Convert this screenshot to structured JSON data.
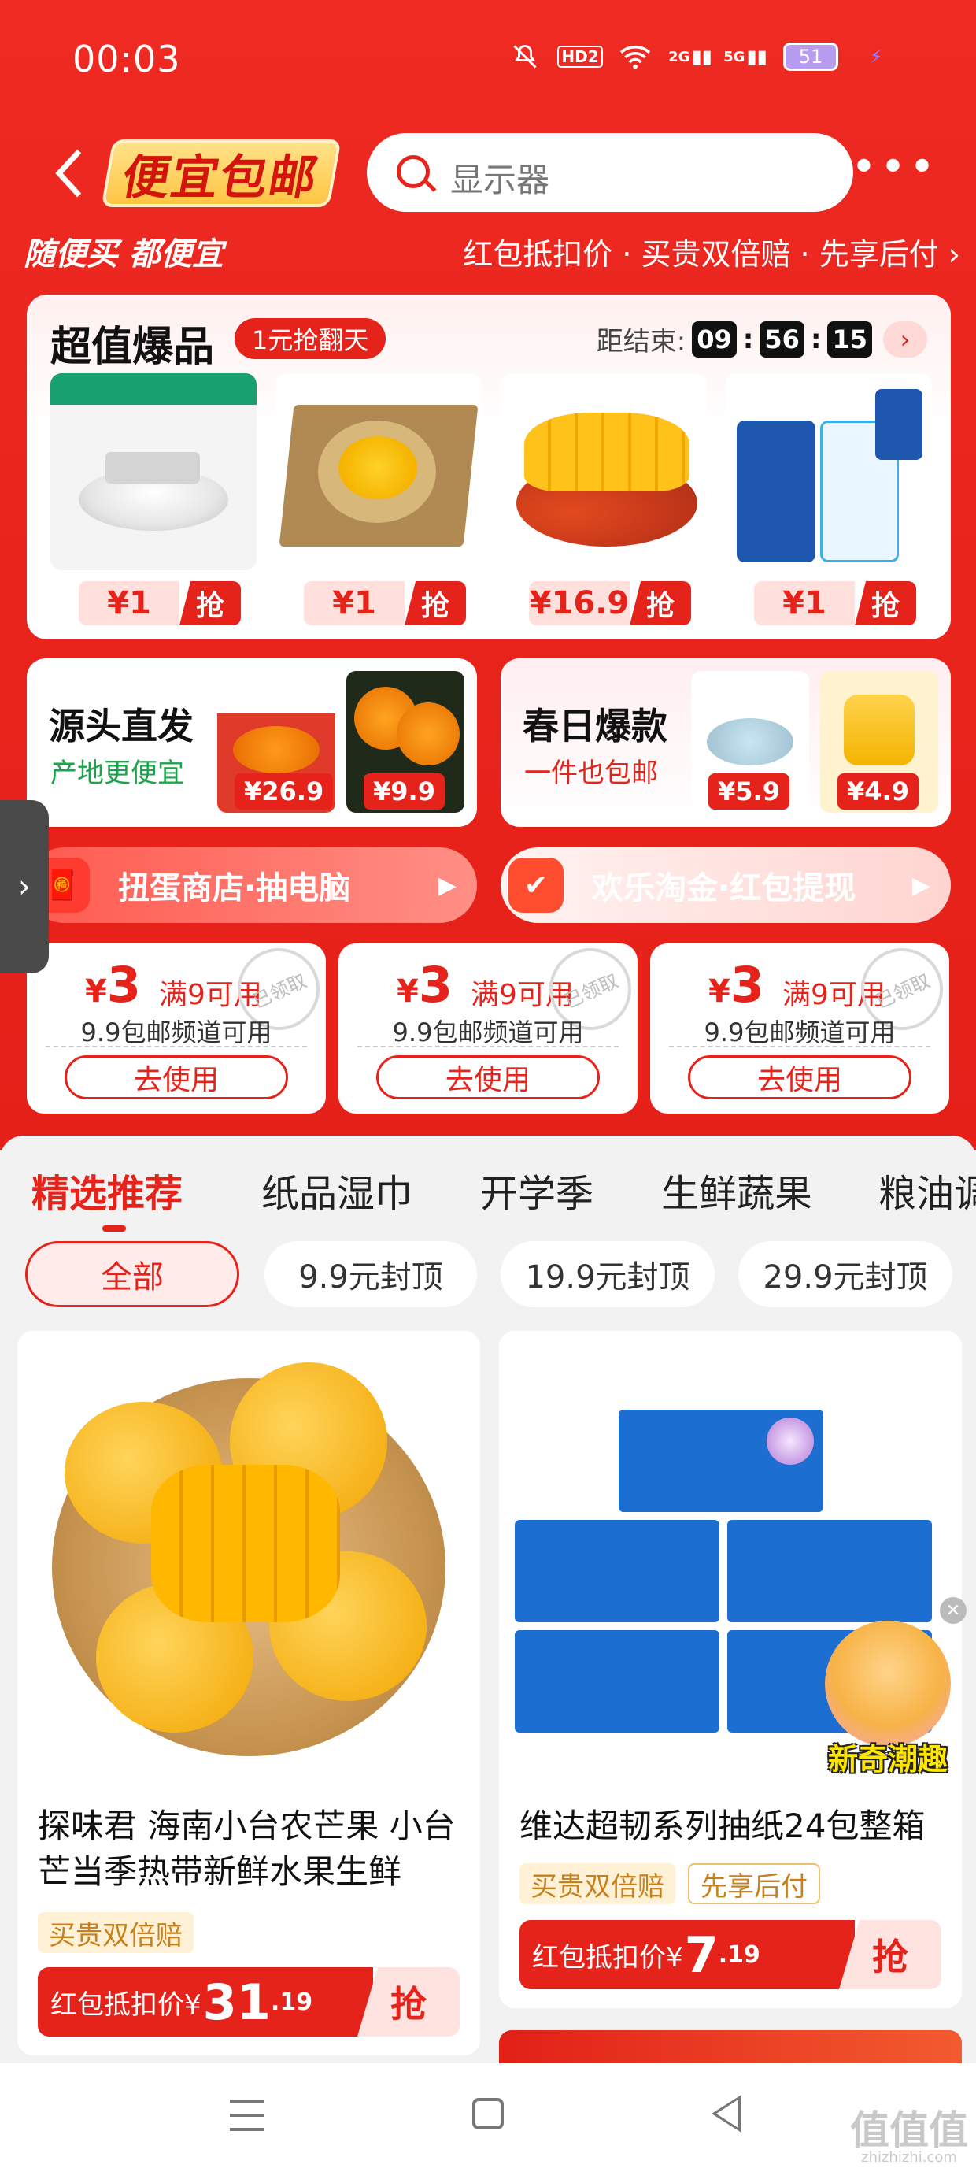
{
  "status_bar": {
    "time": "00:03",
    "icons": [
      "mute-icon",
      "hd-icon",
      "wifi-icon",
      "signal-2g-icon",
      "signal-5g-icon",
      "charging-icon"
    ],
    "hd_label": "HD2",
    "signal_1": "2G",
    "signal_2": "5G",
    "battery": "51"
  },
  "header": {
    "brand": "便宜包邮",
    "search_placeholder": "显示器"
  },
  "slogan": {
    "left": "随便买 都便宜",
    "right": "红包抵扣价 · 买贵双倍赔 · 先享后付 ›"
  },
  "hot_deals": {
    "title": "超值爆品",
    "tag": "1元抢翻天",
    "countdown_label": "距结束:",
    "hours": "09",
    "minutes": "56",
    "seconds": "15",
    "items": [
      {
        "price": "¥1",
        "button": "抢",
        "image": "downlight-icon"
      },
      {
        "price": "¥1",
        "button": "抢",
        "image": "dried-fruit-icon"
      },
      {
        "price": "¥16.9",
        "button": "抢",
        "image": "mango-icon"
      },
      {
        "price": "¥1",
        "button": "抢",
        "image": "pet-wipes-icon"
      }
    ]
  },
  "mini_cards": [
    {
      "title": "源头直发",
      "subtitle": "产地更便宜",
      "prices": [
        "¥26.9",
        "¥9.9"
      ]
    },
    {
      "title": "春日爆款",
      "subtitle": "一件也包邮",
      "prices": [
        "¥5.9",
        "¥4.9"
      ]
    }
  ],
  "pills": [
    {
      "label": "扭蛋商店·抽电脑"
    },
    {
      "label": "欢乐淘金·红包提现"
    }
  ],
  "coupons": [
    {
      "currency": "¥",
      "amount": "3",
      "condition": "满9可用",
      "stamp": "已领取",
      "desc": "9.9包邮频道可用",
      "button": "去使用"
    },
    {
      "currency": "¥",
      "amount": "3",
      "condition": "满9可用",
      "stamp": "已领取",
      "desc": "9.9包邮频道可用",
      "button": "去使用"
    },
    {
      "currency": "¥",
      "amount": "3",
      "condition": "满9可用",
      "stamp": "已领取",
      "desc": "9.9包邮频道可用",
      "button": "去使用"
    }
  ],
  "tabs": [
    "精选推荐",
    "纸品湿巾",
    "开学季",
    "生鲜蔬果",
    "粮油调"
  ],
  "chips": [
    "全部",
    "9.9元封顶",
    "19.9元封顶",
    "29.9元封顶"
  ],
  "products": [
    {
      "title": "探味君 海南小台农芒果 小台芒当季热带新鲜水果生鲜",
      "tags": [
        "买贵双倍赔"
      ],
      "price_label": "红包抵扣价¥",
      "price_int": "31",
      "price_dec": ".19",
      "button": "抢"
    },
    {
      "title": "维达超韧系列抽纸24包整箱",
      "tags": [
        "买贵双倍赔",
        "先享后付"
      ],
      "price_label": "红包抵扣价¥",
      "price_int": "7",
      "price_dec": ".19",
      "button": "抢"
    }
  ],
  "floating_ad": {
    "label": "新奇潮趣"
  },
  "watermark": {
    "main": "值值值",
    "sub": "zhizhizhi.com"
  },
  "colors": {
    "brand_red": "#e6231b",
    "tag_gold": "#c7801c"
  }
}
